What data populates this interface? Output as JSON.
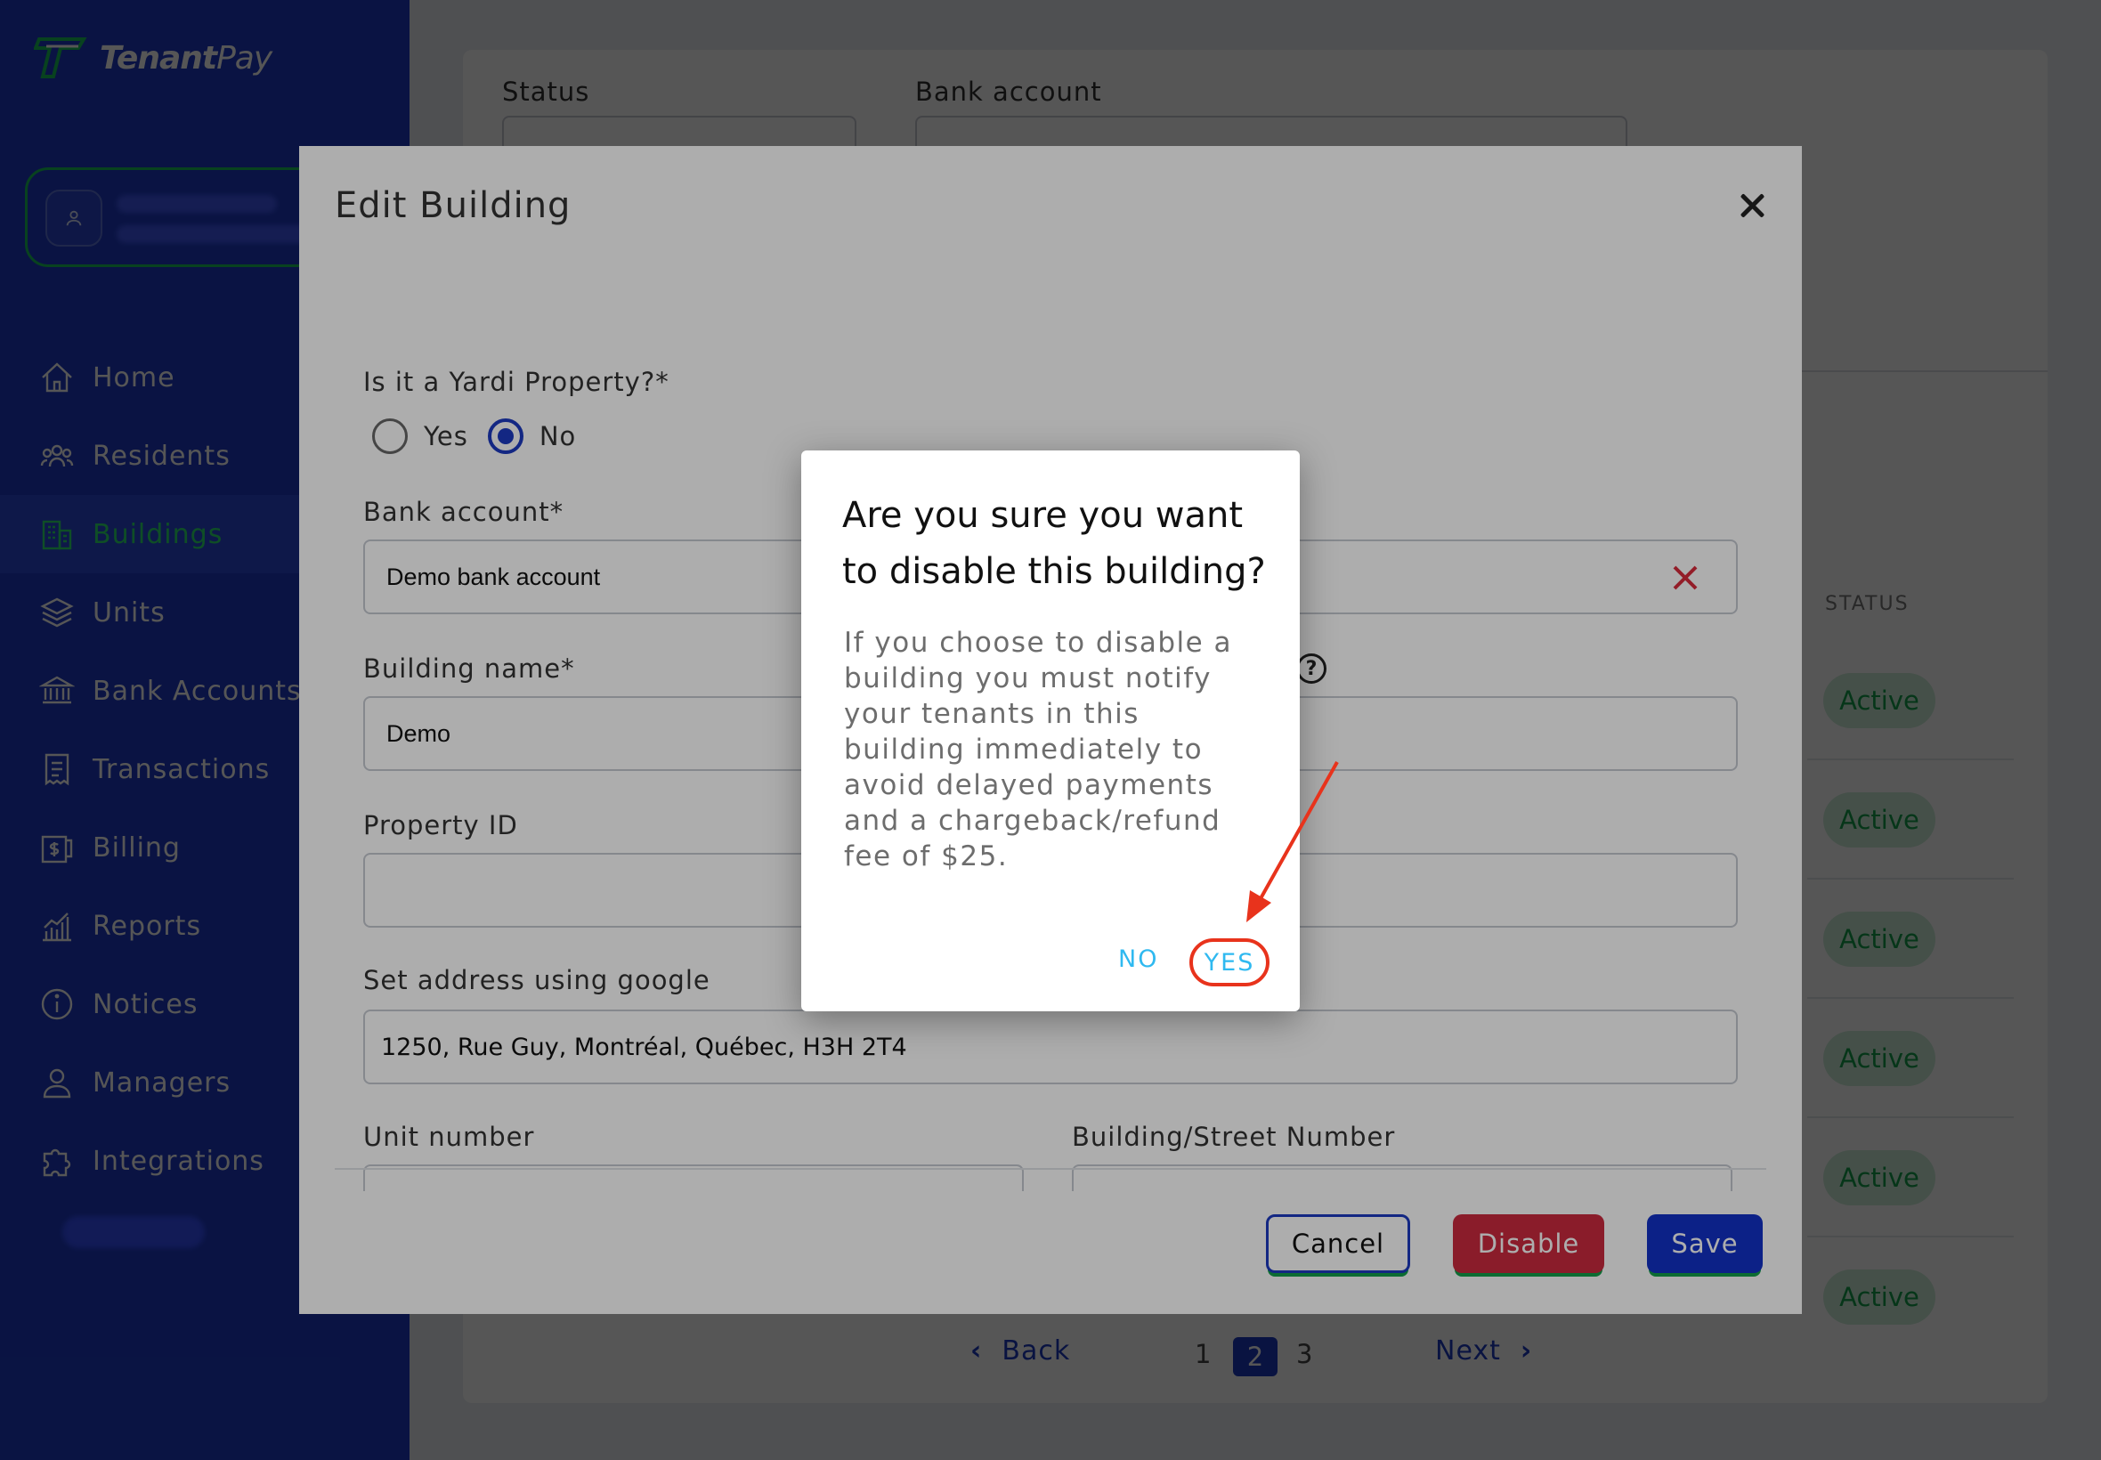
{
  "app": {
    "logo_text_bold": "Tenant",
    "logo_text": "Pay"
  },
  "sidebar": {
    "items": [
      {
        "label": "Home",
        "icon": "home-icon"
      },
      {
        "label": "Residents",
        "icon": "people-icon"
      },
      {
        "label": "Buildings",
        "icon": "building-icon",
        "active": true
      },
      {
        "label": "Units",
        "icon": "layers-icon"
      },
      {
        "label": "Bank Accounts",
        "icon": "bank-icon"
      },
      {
        "label": "Transactions",
        "icon": "receipt-icon"
      },
      {
        "label": "Billing",
        "icon": "billing-icon"
      },
      {
        "label": "Reports",
        "icon": "chart-icon"
      },
      {
        "label": "Notices",
        "icon": "info-icon"
      },
      {
        "label": "Managers",
        "icon": "person-icon"
      },
      {
        "label": "Integrations",
        "icon": "puzzle-icon"
      }
    ]
  },
  "background": {
    "status_label": "Status",
    "bank_account_label": "Bank account",
    "table_status_header": "STATUS",
    "row_status": [
      "Active",
      "Active",
      "Active",
      "Active",
      "Active",
      "Active"
    ],
    "pager": {
      "back": "Back",
      "next": "Next",
      "pages": [
        "1",
        "2",
        "3"
      ],
      "current": "2"
    }
  },
  "edit_modal": {
    "title": "Edit Building",
    "yardi_label": "Is it a Yardi Property?*",
    "yardi_options": [
      "Yes",
      "No"
    ],
    "yardi_selected": "No",
    "bank_account_label": "Bank account*",
    "bank_account_value": "Demo bank account",
    "building_name_label": "Building name*",
    "building_name_value": "Demo",
    "property_id_label": "Property ID",
    "property_id_value": "",
    "address_label": "Set address using google",
    "address_value": "1250, Rue Guy, Montréal, Québec, H3H 2T4",
    "unit_number_label": "Unit number",
    "street_number_label": "Building/Street Number",
    "buttons": {
      "cancel": "Cancel",
      "disable": "Disable",
      "save": "Save"
    }
  },
  "confirm_dialog": {
    "title": "Are you sure you want to disable this building?",
    "body": "If you choose to disable a building you must notify your tenants in this building immediately to avoid delayed payments and a chargeback/refund fee of $25.",
    "no": "NO",
    "yes": "YES"
  },
  "colors": {
    "sidebar": "#1f3ac6",
    "active_nav": "#2ee870",
    "primary": "#1c3ac2",
    "danger": "#cc2a3f",
    "dialog_action": "#2fb9f0",
    "annotation": "#e8331c",
    "status_badge_text": "#12a04b"
  }
}
